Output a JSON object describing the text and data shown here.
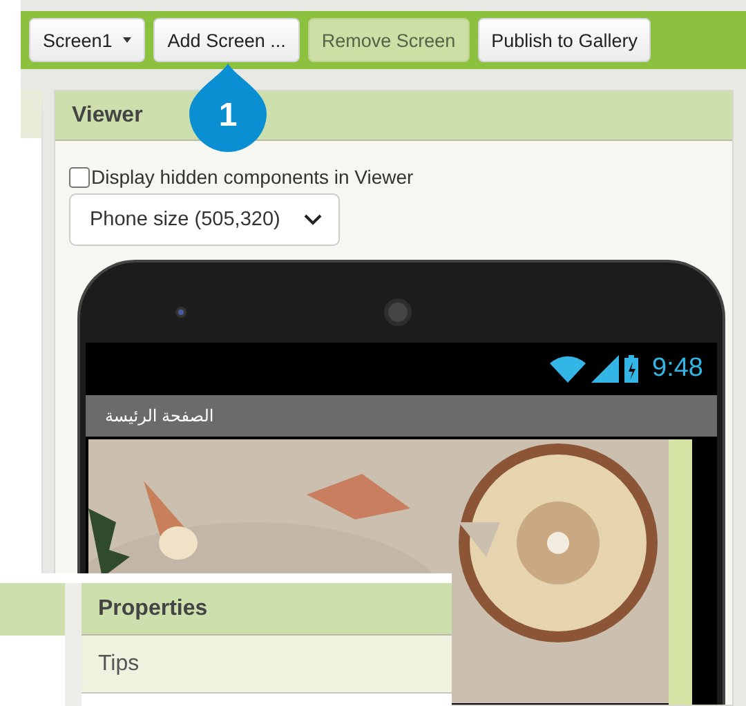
{
  "toolbar": {
    "buttons": [
      {
        "label": "Screen1",
        "kind": "dropdown",
        "disabled": false
      },
      {
        "label": "Add Screen ...",
        "kind": "button",
        "disabled": false
      },
      {
        "label": "Remove Screen",
        "kind": "button",
        "disabled": true
      },
      {
        "label": "Publish to Gallery",
        "kind": "button",
        "disabled": false
      }
    ]
  },
  "callout": {
    "label": "1"
  },
  "viewer": {
    "title": "Viewer",
    "hidden_components": {
      "label": "Display hidden components in Viewer",
      "checked": false
    },
    "size_select": {
      "value": "Phone size (505,320)"
    },
    "phone": {
      "time": "9:48",
      "screen_title": "الصفحة الرئيسة"
    }
  },
  "properties": {
    "title": "Properties",
    "items": [
      "Tips"
    ]
  }
}
